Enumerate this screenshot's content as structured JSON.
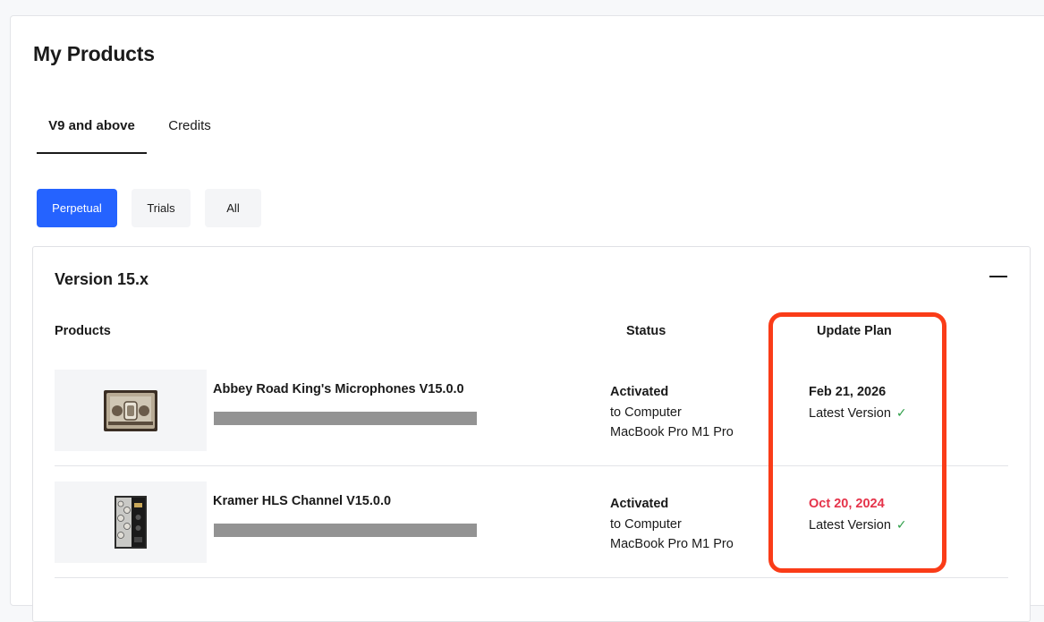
{
  "page": {
    "title": "My Products"
  },
  "tabs": [
    {
      "label": "V9 and above",
      "active": true
    },
    {
      "label": "Credits",
      "active": false
    }
  ],
  "filters": [
    {
      "label": "Perpetual",
      "active": true
    },
    {
      "label": "Trials",
      "active": false
    },
    {
      "label": "All",
      "active": false
    }
  ],
  "version_group": {
    "title": "Version 15.x",
    "columns": {
      "products": "Products",
      "status": "Status",
      "update_plan": "Update Plan"
    },
    "products": [
      {
        "name": "Abbey Road King's Microphones V15.0.0",
        "status": {
          "state": "Activated",
          "line2": "to Computer",
          "line3": "MacBook Pro M1 Pro"
        },
        "plan": {
          "date": "Feb 21, 2026",
          "version_text": "Latest Version",
          "expired": false
        }
      },
      {
        "name": "Kramer HLS Channel V15.0.0",
        "status": {
          "state": "Activated",
          "line2": "to Computer",
          "line3": "MacBook Pro M1 Pro"
        },
        "plan": {
          "date": "Oct 20, 2024",
          "version_text": "Latest Version",
          "expired": true
        }
      }
    ]
  },
  "colors": {
    "accent": "#2563ff",
    "expired_date": "#e5334a",
    "check": "#2e9e48",
    "highlight": "#fa3c18"
  },
  "icons": {
    "collapse": "minus-icon",
    "check": "check-icon"
  }
}
